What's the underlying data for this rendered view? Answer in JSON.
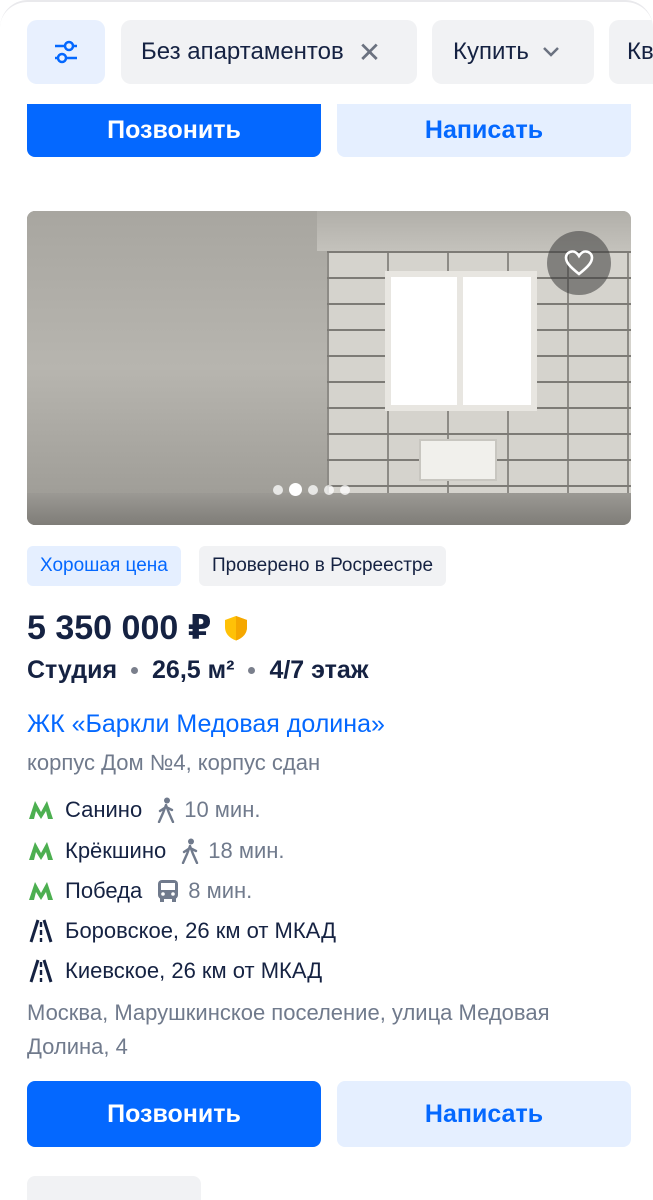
{
  "filters": {
    "apartments_chip": "Без апартаментов",
    "deal_chip": "Купить",
    "more_chip": "Кв"
  },
  "actions_top": {
    "call": "Позвонить",
    "write": "Написать"
  },
  "listing": {
    "photo_count": 5,
    "active_photo": 2,
    "badges": [
      "Хорошая цена",
      "Проверено в Росреестре"
    ],
    "price": "5 350 000 ₽",
    "type": "Студия",
    "area": "26,5 м²",
    "floor": "4/7 этаж",
    "complex": "ЖК «Баркли Медовая долина»",
    "building": "корпус Дом №4, корпус сдан",
    "metro": [
      {
        "name": "Санино",
        "time": "10 мин.",
        "transport": "walk"
      },
      {
        "name": "Крёкшино",
        "time": "18 мин.",
        "transport": "walk"
      },
      {
        "name": "Победа",
        "time": "8 мин.",
        "transport": "bus"
      }
    ],
    "highways": [
      {
        "text": "Боровское, 26 км от МКАД"
      },
      {
        "text": "Киевское, 26 км от МКАД"
      }
    ],
    "address": "Москва, Марушкинское поселение, улица Медовая Долина, 4"
  },
  "actions_bottom": {
    "call": "Позвонить",
    "write": "Написать"
  },
  "colors": {
    "accent": "#0468ff",
    "metro": "#4caf50",
    "text": "#152242",
    "muted": "#707a8c"
  }
}
